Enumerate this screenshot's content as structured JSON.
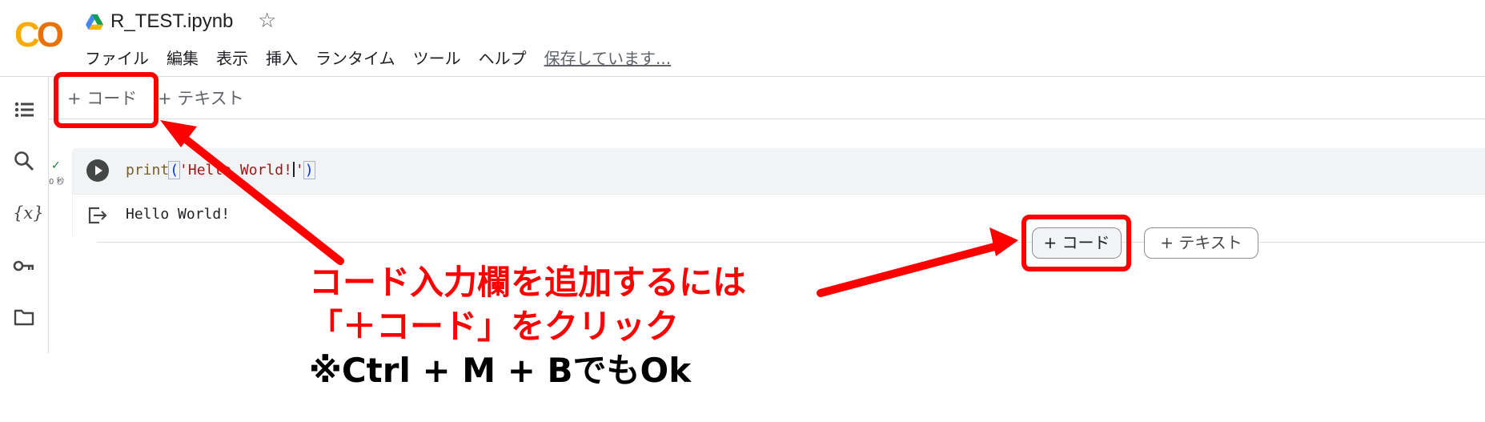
{
  "app": {
    "file_name": "R_TEST.ipynb",
    "logo_text": "CO"
  },
  "menu": {
    "items": [
      "ファイル",
      "編集",
      "表示",
      "挿入",
      "ランタイム",
      "ツール",
      "ヘルプ"
    ],
    "saving_status": "保存しています..."
  },
  "toolbar": {
    "add_code": "+ コード",
    "add_text": "+ テキスト"
  },
  "sidebar": {
    "icons": [
      "toc-icon",
      "search-icon",
      "variables-icon",
      "secrets-key-icon",
      "folder-icon"
    ],
    "variables_label": "{x}"
  },
  "cell": {
    "status_mark": "✓",
    "exec_time": "0 秒",
    "code_fn": "print",
    "code_open": "(",
    "code_str_before_cursor": "'Hello World!",
    "code_str_after_cursor": "'",
    "code_close": ")",
    "output": "Hello World!"
  },
  "inline_buttons": {
    "add_code": "+ コード",
    "add_text": "+ テキスト"
  },
  "annotation": {
    "line1": "コード入力欄を追加するには",
    "line2": "「＋コード」をクリック",
    "line3": "※Ctrl + M + BでもOk"
  },
  "colors": {
    "annotation_red": "#ff0000",
    "logo_yellow": "#f9ab00",
    "logo_orange": "#e8710a"
  }
}
